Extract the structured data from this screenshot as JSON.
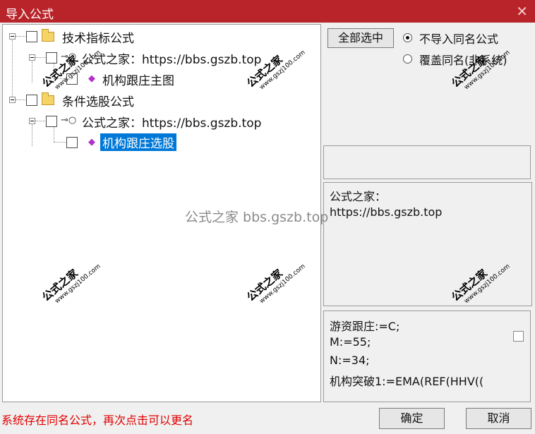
{
  "window": {
    "title": "导入公式",
    "close": "✕"
  },
  "tree": {
    "nodes": [
      {
        "label": "技术指标公式"
      },
      {
        "label": "公式之家：https://bbs.gszb.top"
      },
      {
        "label": "机构跟庄主图"
      },
      {
        "label": "条件选股公式"
      },
      {
        "label": "公式之家：https://bbs.gszb.top"
      },
      {
        "label": "机构跟庄选股"
      }
    ],
    "icons": {
      "key": "⊸○",
      "gem": "◆",
      "minus": "−"
    }
  },
  "options": {
    "select_all_label": "全部选中",
    "radio_no_import": "不导入同名公式",
    "radio_overwrite": "覆盖同名(非系统)"
  },
  "info": {
    "line1": "公式之家：",
    "line2": "https://bbs.gszb.top"
  },
  "code": {
    "lines": [
      "游资跟庄:=C;",
      "M:=55;",
      "N:=34;",
      "机构突破1:=EMA(REF(HHV(("
    ]
  },
  "watermark": {
    "center": "公式之家 bbs.gszb.top",
    "big": "公式之家",
    "small": "www.gszj100.com"
  },
  "status": "系统存在同名公式，再次点击可以更名",
  "buttons": {
    "ok": "确定",
    "cancel": "取消"
  }
}
